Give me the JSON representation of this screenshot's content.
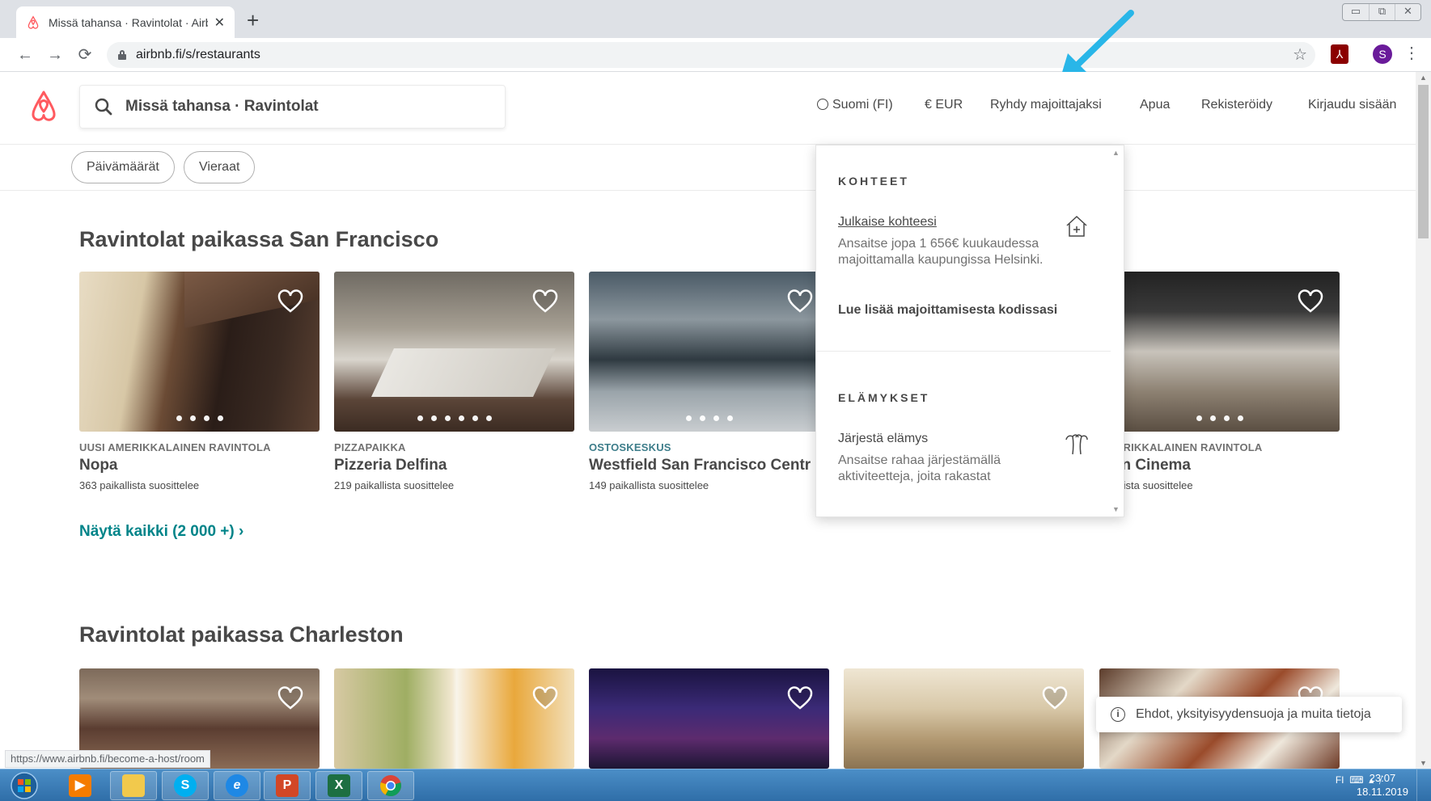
{
  "browser": {
    "tab_title": "Missä tahansa · Ravintolat · Airbn",
    "new_tab_symbol": "+",
    "close_symbol": "✕",
    "url": "airbnb.fi/s/restaurants",
    "window_controls": [
      "▭",
      "⧉",
      "✕"
    ],
    "status_url": "https://www.airbnb.fi/become-a-host/room",
    "profile_initial": "S"
  },
  "header": {
    "search_text": "Missä tahansa · Ravintolat",
    "language": "Suomi (FI)",
    "currency": "€ EUR",
    "host_link": "Ryhdy majoittajaksi",
    "help": "Apua",
    "signup": "Rekisteröidy",
    "login": "Kirjaudu sisään"
  },
  "filters": {
    "dates": "Päivämäärät",
    "guests": "Vieraat"
  },
  "section1": {
    "title": "Ravintolat paikassa San Francisco",
    "show_all": "Näytä kaikki (2 000 +)",
    "show_all_chevron": "›",
    "cards": [
      {
        "category": "UUSI AMERIKKALAINEN RAVINTOLA",
        "name": "Nopa",
        "recommend": "363 paikallista suosittelee",
        "dots": 4
      },
      {
        "category": "PIZZAPAIKKA",
        "name": "Pizzeria Delfina",
        "recommend": "219 paikallista suosittelee",
        "dots": 6
      },
      {
        "category": "OSTOSKESKUS",
        "name": "Westfield San Francisco Centr",
        "recommend": "149 paikallista suosittelee",
        "dots": 4
      },
      {
        "category": "AMERIKKALAINEN RAVINTOLA",
        "name": "eign Cinema",
        "recommend": "aikallista suosittelee",
        "dots": 4
      }
    ]
  },
  "section2": {
    "title": "Ravintolat paikassa Charleston"
  },
  "dropdown": {
    "heading1": "KOHTEET",
    "publish_title": "Julkaise kohteesi",
    "publish_desc": "Ansaitse jopa 1 656€ kuukaudessa majoittamalla kaupungissa Helsinki.",
    "learn_more": "Lue lisää majoittamisesta kodissasi",
    "heading2": "ELÄMYKSET",
    "experience_title": "Järjestä elämys",
    "experience_desc": "Ansaitse rahaa järjestämällä aktiviteetteja, joita rakastat"
  },
  "cookie_banner": {
    "text": "Ehdot, yksityisyydensuoja ja muita tietoja"
  },
  "taskbar": {
    "tray_lang": "FI",
    "time": "23:07",
    "date": "18.11.2019",
    "apps": [
      {
        "name": "windows-media-player-icon",
        "label": "▶",
        "color": "#f57c00"
      },
      {
        "name": "file-explorer-icon",
        "label": "",
        "color": "#f2c94c"
      },
      {
        "name": "skype-icon",
        "label": "S",
        "color": "#00aff0"
      },
      {
        "name": "internet-explorer-icon",
        "label": "e",
        "color": "#1e88e5"
      },
      {
        "name": "powerpoint-icon",
        "label": "P",
        "color": "#d24726"
      },
      {
        "name": "excel-icon",
        "label": "X",
        "color": "#1d6f42"
      },
      {
        "name": "chrome-icon",
        "label": "",
        "color": "#ffffff"
      }
    ]
  },
  "colors": {
    "brand": "#FF5A5F",
    "teal": "#008489",
    "annotation_arrow": "#29b6e8"
  }
}
